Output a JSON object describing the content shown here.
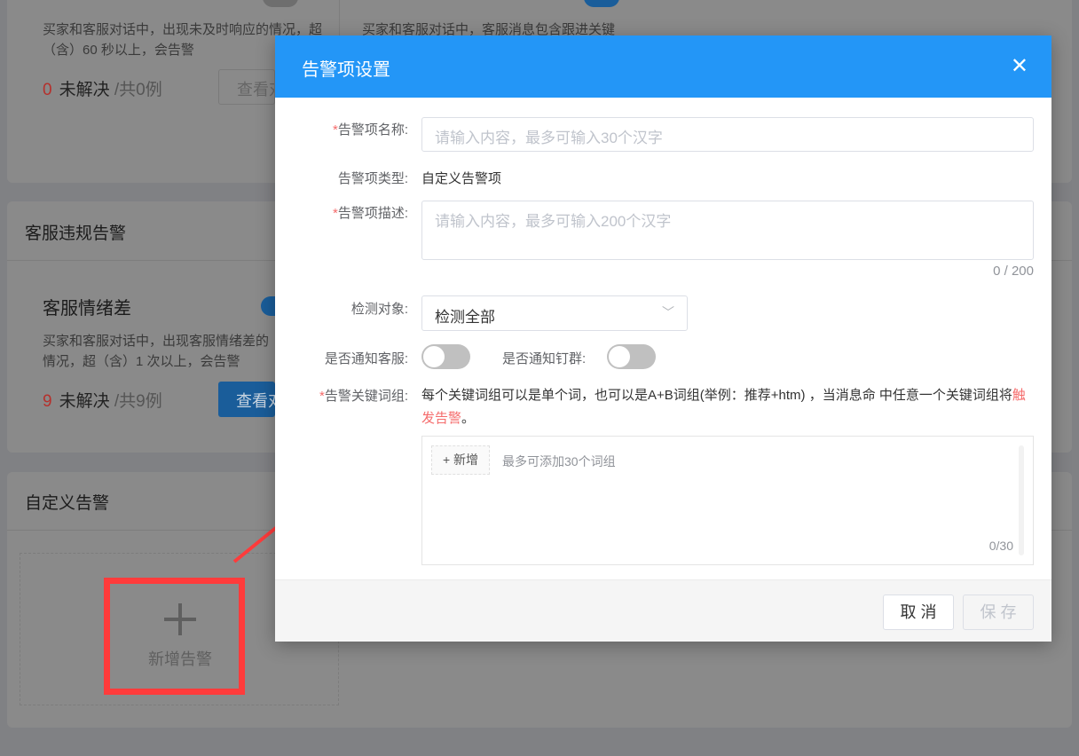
{
  "background": {
    "top_cards": [
      {
        "desc": "买家和客服对话中，出现未及时响应的情况，超（含）60 秒以上，会告警",
        "count": "0",
        "unresolved": "未解决",
        "total": "/共0例",
        "button": "查看对话"
      },
      {
        "desc": "买家和客服对话中，客服消息包含跟进关键"
      }
    ],
    "violation_section": {
      "title": "客服违规告警",
      "card": {
        "name": "客服情绪差",
        "desc": "买家和客服对话中，出现客服情绪差的情况，超（含）1 次以上，会告警",
        "count": "9",
        "unresolved": "未解决",
        "total": "/共9例",
        "button": "查看对话"
      }
    },
    "custom_section": {
      "title": "自定义告警",
      "add_label": "新增告警"
    }
  },
  "modal": {
    "title": "告警项设置",
    "name_label": "告警项名称:",
    "name_placeholder": "请输入内容，最多可输入30个汉字",
    "type_label": "告警项类型:",
    "type_value": "自定义告警项",
    "desc_label": "告警项描述:",
    "desc_placeholder": "请输入内容，最多可输入200个汉字",
    "desc_counter": "0 / 200",
    "target_label": "检测对象:",
    "target_value": "检测全部",
    "notify_cs_label": "是否通知客服:",
    "notify_cs_on": false,
    "notify_ding_label": "是否通知钉群:",
    "notify_ding_on": false,
    "keywords_label": "告警关键词组:",
    "keywords_hint": "每个关键词组可以是单个词，也可以是A+B词组(举例：推荐+htm) ，当消息命 中任意一个关键词组将",
    "keywords_hint_em": "触发告警",
    "keywords_hint_end": "。",
    "add_button": "+ 新增",
    "add_hint": "最多可添加30个词组",
    "keywords_counter": "0/30",
    "cancel": "取 消",
    "save": "保 存"
  },
  "colors": {
    "primary": "#2396f7",
    "danger": "#f56c6c",
    "annotation": "#ff3b3b"
  }
}
